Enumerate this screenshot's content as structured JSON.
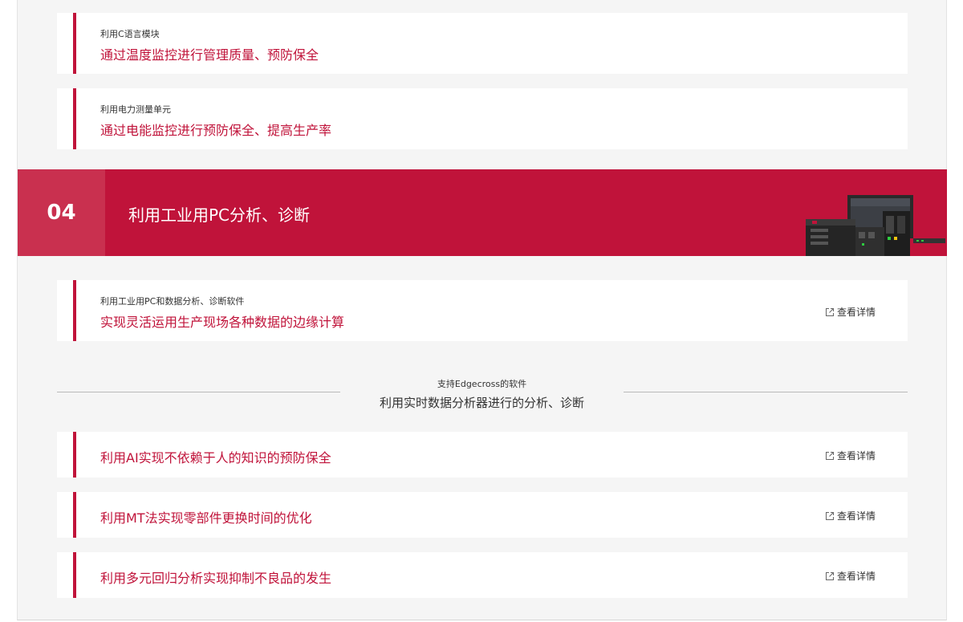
{
  "top_cards": [
    {
      "sub": "利用C语言模块",
      "main": "通过温度监控进行管理质量、预防保全"
    },
    {
      "sub": "利用电力测量单元",
      "main": "通过电能监控进行预防保全、提高生产率"
    }
  ],
  "banner": {
    "number": "04",
    "title": "利用工业用PC分析、诊断"
  },
  "pc_card": {
    "sub": "利用工业用PC和数据分析、诊断软件",
    "main": "实现灵活运用生产现场各种数据的边缘计算",
    "detail": "查看详情"
  },
  "section": {
    "sub": "支持Edgecross的软件",
    "title": "利用实时数据分析器进行的分析、诊断"
  },
  "list_cards": [
    {
      "main": "利用AI实现不依赖于人的知识的预防保全",
      "detail": "查看详情"
    },
    {
      "main": "利用MT法实现零部件更换时间的优化",
      "detail": "查看详情"
    },
    {
      "main": "利用多元回归分析实现抑制不良品的发生",
      "detail": "查看详情"
    }
  ],
  "colors": {
    "accent": "#c0133a",
    "banner_number_bg": "#c9304f",
    "panel_bg": "#f5f5f5"
  }
}
